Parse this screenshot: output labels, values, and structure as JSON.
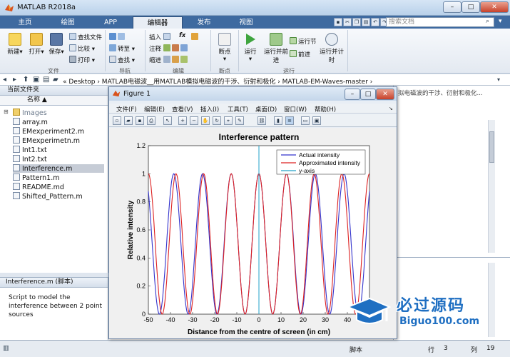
{
  "window": {
    "title": "MATLAB R2018a",
    "min": "–",
    "max": "□",
    "close": "✕"
  },
  "tabs": [
    "主页",
    "绘图",
    "APP",
    "编辑器",
    "发布",
    "视图"
  ],
  "search": {
    "placeholder": "搜索文档"
  },
  "ribbon": {
    "file": {
      "new": "新建",
      "open": "打开",
      "save": "保存",
      "find_files": "查找文件",
      "compare": "比较",
      "print": "打印",
      "group": "文件"
    },
    "nav": {
      "goto": "转至",
      "find": "查找",
      "group": "导航"
    },
    "edit": {
      "insert": "插入",
      "fx": "fx",
      "comment": "注释",
      "indent": "缩进",
      "group": "编辑"
    },
    "breakpoints": {
      "label": "断点",
      "group": "断点"
    },
    "run": {
      "run": "运行",
      "run_advance": "运行并前进",
      "run_section": "运行节",
      "advance": "前进",
      "run_time": "运行并计时",
      "group": "运行"
    }
  },
  "address": {
    "path": "« Desktop › MATLAB电磁波__用MATLAB模拟电磁波的干涉、衍射和极化 › MATLAB-EM-Waves-master ›"
  },
  "current_folder": {
    "header": "当前文件夹",
    "col_name": "名称 ▲",
    "items": [
      "Images",
      "array.m",
      "EMexperiment2.m",
      "EMexperimetn.m",
      "Int1.txt",
      "Int2.txt",
      "Interference.m",
      "Pattern1.m",
      "README.md",
      "Shifted_Pattern.m"
    ],
    "selected": "Interference.m"
  },
  "details": {
    "title": "Interference.m  (脚本)",
    "description": "Script to model the interference between 2 point sources"
  },
  "right_panel": {
    "path_tail": "拟电磁波的干涉、衍射和极化..."
  },
  "status": {
    "type": "脚本",
    "row_label": "行",
    "row": "3",
    "col_label": "列",
    "col": "19"
  },
  "figure": {
    "title": "Figure 1",
    "menu": [
      "文件(F)",
      "编辑(E)",
      "查看(V)",
      "插入(I)",
      "工具(T)",
      "桌面(D)",
      "窗口(W)",
      "帮助(H)"
    ]
  },
  "chart_data": {
    "type": "line",
    "title": "Interference pattern",
    "xlabel": "Distance from the centre of screen (in cm)",
    "ylabel": "Relative intensity",
    "xlim": [
      -50,
      50
    ],
    "ylim": [
      0,
      1.2
    ],
    "xticks": [
      -50,
      -40,
      -30,
      -20,
      -10,
      0,
      10,
      20,
      30,
      40,
      50
    ],
    "yticks": [
      0,
      0.2,
      0.4,
      0.6,
      0.8,
      1,
      1.2
    ],
    "series": [
      {
        "name": "Actual intensity",
        "color": "#3333cc",
        "formula": "cos^2",
        "peaks_x": [
          -38.5,
          -25.5,
          -12.5,
          0,
          12.5,
          25.5,
          38.5
        ]
      },
      {
        "name": "Approximated intensity",
        "color": "#dd2222",
        "formula": "cos^2",
        "peaks_x": [
          -37.5,
          -25,
          -12.5,
          0,
          12.5,
          25,
          37.5
        ]
      },
      {
        "name": "y-axis",
        "color": "#22a0c8",
        "x": [
          0,
          0
        ],
        "y": [
          0,
          1.2
        ]
      }
    ],
    "legend": "top-right",
    "grid": false
  },
  "watermark": {
    "brand": "必过源码",
    "site": "Biguo100.com"
  },
  "colors": {
    "tab_bar": "#3e6aa0",
    "actual": "#3333cc",
    "approx": "#dd2222",
    "yaxis": "#22a0c8"
  }
}
